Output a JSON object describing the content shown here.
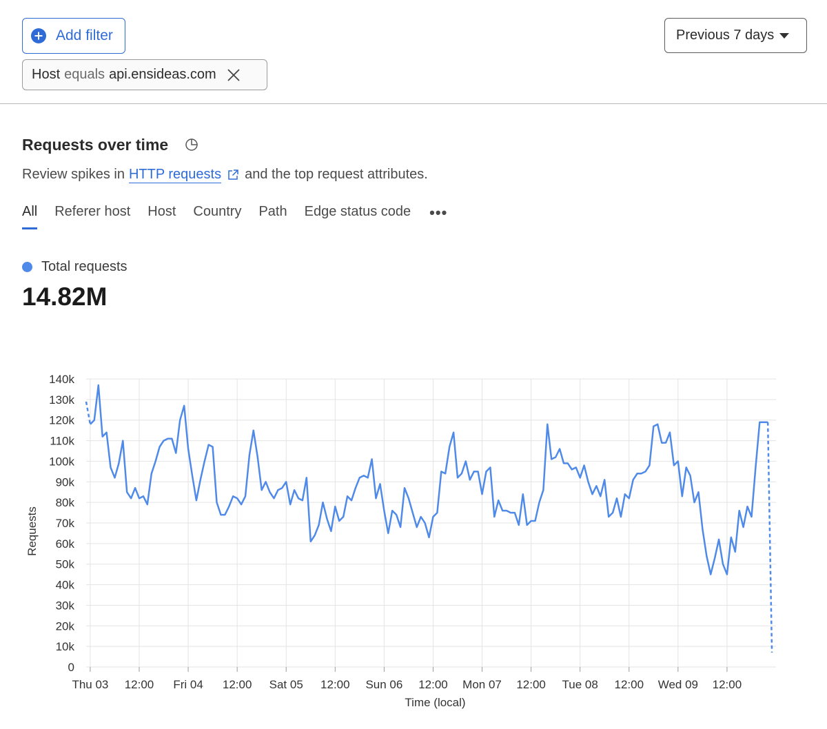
{
  "toolbar": {
    "add_filter_label": "Add filter",
    "date_range_label": "Previous 7 days"
  },
  "filter_chip": {
    "field": "Host",
    "operator": "equals",
    "value": "api.ensideas.com"
  },
  "section": {
    "title": "Requests over time",
    "subtitle_before": "Review spikes in",
    "subtitle_link": "HTTP requests",
    "subtitle_after": "and the top request attributes."
  },
  "tabs": [
    {
      "label": "All",
      "active": true
    },
    {
      "label": "Referer host",
      "active": false
    },
    {
      "label": "Host",
      "active": false
    },
    {
      "label": "Country",
      "active": false
    },
    {
      "label": "Path",
      "active": false
    },
    {
      "label": "Edge status code",
      "active": false
    }
  ],
  "more_label": "•••",
  "legend": {
    "label": "Total requests",
    "total": "14.82M",
    "color": "#4f8ae8"
  },
  "colors": {
    "accent": "#2f6bd7",
    "series": "#4f8ae8",
    "grid": "#e3e3e3"
  },
  "chart_data": {
    "type": "line",
    "title": "",
    "xlabel": "Time (local)",
    "ylabel": "Requests",
    "ylim": [
      0,
      140000
    ],
    "yticks": [
      0,
      10000,
      20000,
      30000,
      40000,
      50000,
      60000,
      70000,
      80000,
      90000,
      100000,
      110000,
      120000,
      130000,
      140000
    ],
    "ytick_labels": [
      "0",
      "10k",
      "20k",
      "30k",
      "40k",
      "50k",
      "60k",
      "70k",
      "80k",
      "90k",
      "100k",
      "110k",
      "120k",
      "130k",
      "140k"
    ],
    "xlim_hours": [
      -1,
      168
    ],
    "xticks_hours": [
      0,
      12,
      24,
      36,
      48,
      60,
      72,
      84,
      96,
      108,
      120,
      132,
      144,
      156
    ],
    "xtick_labels": [
      "Thu 03",
      "12:00",
      "Fri 04",
      "12:00",
      "Sat 05",
      "12:00",
      "Sun 06",
      "12:00",
      "Mon 07",
      "12:00",
      "Tue 08",
      "12:00",
      "Wed 09",
      "12:00"
    ],
    "grid": true,
    "series": [
      {
        "name": "Total requests",
        "start_hour": -1,
        "dashed_first_segment": true,
        "dashed_last_segment": true,
        "values": [
          129000,
          118000,
          120000,
          137000,
          112000,
          114000,
          97000,
          92000,
          99000,
          110000,
          85000,
          82000,
          87000,
          82000,
          83000,
          79000,
          94000,
          100000,
          107000,
          110000,
          111000,
          111000,
          104000,
          120000,
          127000,
          106000,
          93000,
          81000,
          91000,
          100000,
          108000,
          107000,
          80000,
          74000,
          74000,
          78000,
          83000,
          82000,
          79000,
          83000,
          103000,
          115000,
          102000,
          86000,
          90000,
          85000,
          82000,
          86000,
          87000,
          90000,
          79000,
          86000,
          82000,
          81000,
          92000,
          61000,
          64000,
          69000,
          80000,
          72000,
          66000,
          78000,
          71000,
          73000,
          83000,
          81000,
          87000,
          92000,
          93000,
          92000,
          101000,
          82000,
          89000,
          76000,
          65000,
          76000,
          74000,
          68000,
          87000,
          82000,
          75000,
          68000,
          73000,
          70000,
          63000,
          73000,
          75000,
          95000,
          94000,
          107000,
          114000,
          92000,
          94000,
          100000,
          91000,
          95000,
          95000,
          84000,
          95000,
          97000,
          73000,
          81000,
          76000,
          76000,
          75000,
          75000,
          69000,
          84000,
          69000,
          71000,
          71000,
          80000,
          86000,
          118000,
          101000,
          102000,
          106000,
          99000,
          99000,
          96000,
          97000,
          92000,
          98000,
          90000,
          84000,
          88000,
          83000,
          91000,
          73000,
          75000,
          82000,
          73000,
          84000,
          82000,
          91000,
          94000,
          94000,
          95000,
          98000,
          117000,
          118000,
          109000,
          109000,
          114000,
          98000,
          100000,
          83000,
          97000,
          93000,
          80000,
          85000,
          67000,
          54000,
          45000,
          53000,
          62000,
          50000,
          45000,
          63000,
          56000,
          76000,
          68000,
          78000,
          73000,
          97000,
          119000,
          119000,
          119000,
          7000
        ]
      }
    ]
  }
}
